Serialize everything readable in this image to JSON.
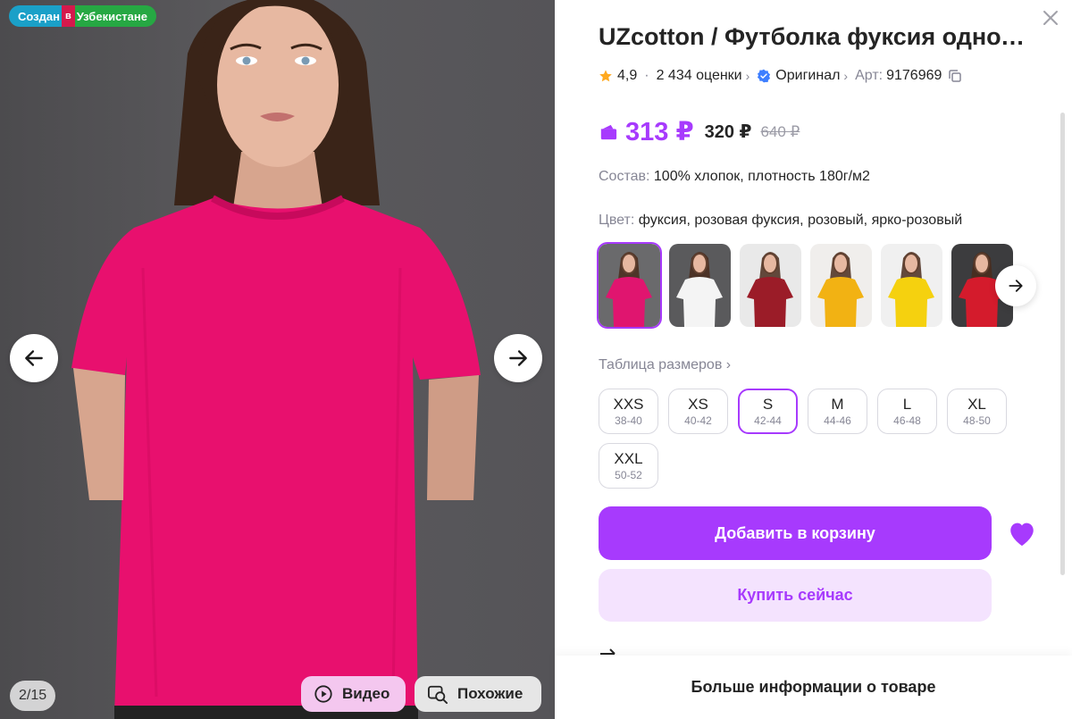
{
  "gallery": {
    "origin_badge": {
      "part1": "Создан",
      "part2": "в",
      "part3": "Узбекистане"
    },
    "counter": "2/15",
    "video_label": "Видео",
    "similar_label": "Похожие",
    "shirt_color": "#e8106e"
  },
  "product": {
    "title": "UZcotton / Футболка фуксия однотонная",
    "rating": "4,9",
    "reviews": "2 434 оценки",
    "original_label": "Оригинал",
    "article_label": "Арт:",
    "article_value": "9176969",
    "price_main": "313 ₽",
    "price_card": "320 ₽",
    "price_old": "640 ₽",
    "composition_label": "Состав:",
    "composition_value": "100% хлопок, плотность 180г/м2",
    "color_label": "Цвет:",
    "color_value": "фуксия, розовая фуксия, розовый, ярко-розовый",
    "size_table_label": "Таблица размеров",
    "add_to_cart": "Добавить в корзину",
    "buy_now": "Купить сейчас",
    "more_info": "Больше информации о товаре"
  },
  "swatches": [
    {
      "color": "#e0156f",
      "bg": "#6a6a6c",
      "selected": true
    },
    {
      "color": "#f4f4f4",
      "bg": "#5a5a5c",
      "selected": false
    },
    {
      "color": "#9b1c28",
      "bg": "#e9e9e9",
      "selected": false
    },
    {
      "color": "#f2b213",
      "bg": "#f0eeec",
      "selected": false
    },
    {
      "color": "#f5d10f",
      "bg": "#f0f0f0",
      "selected": false
    },
    {
      "color": "#d41b2c",
      "bg": "#3c3c3e",
      "selected": false
    }
  ],
  "sizes": [
    {
      "label": "XXS",
      "range": "38-40",
      "selected": false
    },
    {
      "label": "XS",
      "range": "40-42",
      "selected": false
    },
    {
      "label": "S",
      "range": "42-44",
      "selected": true
    },
    {
      "label": "M",
      "range": "44-46",
      "selected": false
    },
    {
      "label": "L",
      "range": "46-48",
      "selected": false
    },
    {
      "label": "XL",
      "range": "48-50",
      "selected": false
    },
    {
      "label": "XXL",
      "range": "50-52",
      "selected": false
    }
  ],
  "colors": {
    "accent": "#a73afd",
    "accent_light": "#f4e3fe",
    "star": "#ffa91f",
    "verified": "#3d7eff"
  }
}
